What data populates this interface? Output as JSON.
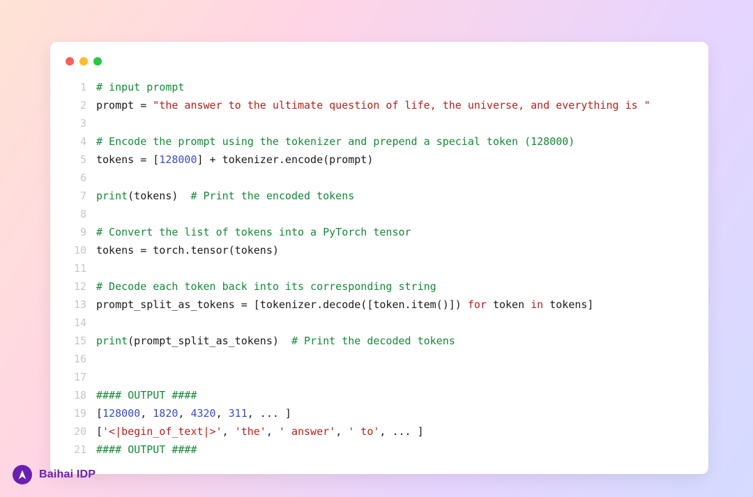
{
  "brand": "Baihai IDP",
  "traffic": {
    "red": "#ff5f57",
    "yellow": "#febc2e",
    "green": "#28c840"
  },
  "code": {
    "lines": [
      {
        "n": 1,
        "tokens": [
          {
            "t": "# input prompt",
            "c": "c-comment"
          }
        ]
      },
      {
        "n": 2,
        "tokens": [
          {
            "t": "prompt = "
          },
          {
            "t": "\"the answer to the ultimate question of life, the universe, and everything is \"",
            "c": "c-str"
          }
        ]
      },
      {
        "n": 3,
        "tokens": [
          {
            "t": ""
          }
        ]
      },
      {
        "n": 4,
        "tokens": [
          {
            "t": "# Encode the prompt using the tokenizer and prepend a special token (128000)",
            "c": "c-comment"
          }
        ]
      },
      {
        "n": 5,
        "tokens": [
          {
            "t": "tokens = ["
          },
          {
            "t": "128000",
            "c": "c-num"
          },
          {
            "t": "] + tokenizer.encode(prompt)"
          }
        ]
      },
      {
        "n": 6,
        "tokens": [
          {
            "t": ""
          }
        ]
      },
      {
        "n": 7,
        "tokens": [
          {
            "t": "print",
            "c": "c-fn"
          },
          {
            "t": "(tokens)  "
          },
          {
            "t": "# Print the encoded tokens",
            "c": "c-comment"
          }
        ]
      },
      {
        "n": 8,
        "tokens": [
          {
            "t": ""
          }
        ]
      },
      {
        "n": 9,
        "tokens": [
          {
            "t": "# Convert the list of tokens into a PyTorch tensor",
            "c": "c-comment"
          }
        ]
      },
      {
        "n": 10,
        "tokens": [
          {
            "t": "tokens = torch.tensor(tokens)"
          }
        ]
      },
      {
        "n": 11,
        "tokens": [
          {
            "t": ""
          }
        ]
      },
      {
        "n": 12,
        "tokens": [
          {
            "t": "# Decode each token back into its corresponding string",
            "c": "c-comment"
          }
        ]
      },
      {
        "n": 13,
        "tokens": [
          {
            "t": "prompt_split_as_tokens = [tokenizer.decode([token.item()]) "
          },
          {
            "t": "for",
            "c": "c-kw"
          },
          {
            "t": " token "
          },
          {
            "t": "in",
            "c": "c-kw"
          },
          {
            "t": " tokens]"
          }
        ]
      },
      {
        "n": 14,
        "tokens": [
          {
            "t": ""
          }
        ]
      },
      {
        "n": 15,
        "tokens": [
          {
            "t": "print",
            "c": "c-fn"
          },
          {
            "t": "(prompt_split_as_tokens)  "
          },
          {
            "t": "# Print the decoded tokens",
            "c": "c-comment"
          }
        ]
      },
      {
        "n": 16,
        "tokens": [
          {
            "t": ""
          }
        ]
      },
      {
        "n": 17,
        "tokens": [
          {
            "t": ""
          }
        ]
      },
      {
        "n": 18,
        "tokens": [
          {
            "t": "#### OUTPUT ####",
            "c": "c-comment"
          }
        ]
      },
      {
        "n": 19,
        "tokens": [
          {
            "t": "["
          },
          {
            "t": "128000",
            "c": "c-num"
          },
          {
            "t": ", "
          },
          {
            "t": "1820",
            "c": "c-num"
          },
          {
            "t": ", "
          },
          {
            "t": "4320",
            "c": "c-num"
          },
          {
            "t": ", "
          },
          {
            "t": "311",
            "c": "c-num"
          },
          {
            "t": ", ... ]"
          }
        ]
      },
      {
        "n": 20,
        "tokens": [
          {
            "t": "["
          },
          {
            "t": "'<|begin_of_text|>'",
            "c": "c-str"
          },
          {
            "t": ", "
          },
          {
            "t": "'the'",
            "c": "c-str"
          },
          {
            "t": ", "
          },
          {
            "t": "' answer'",
            "c": "c-str"
          },
          {
            "t": ", "
          },
          {
            "t": "' to'",
            "c": "c-str"
          },
          {
            "t": ", ... ]"
          }
        ]
      },
      {
        "n": 21,
        "tokens": [
          {
            "t": "#### OUTPUT ####",
            "c": "c-comment"
          }
        ]
      }
    ]
  }
}
